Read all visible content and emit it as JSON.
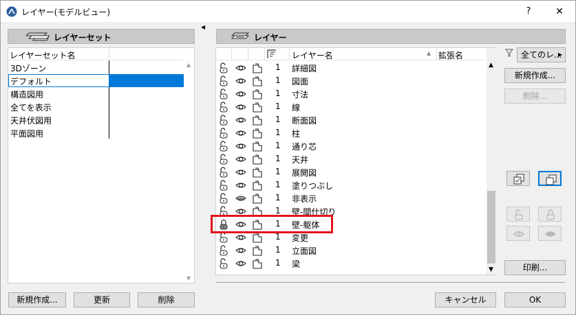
{
  "window": {
    "title": "レイヤー(モデルビュー)",
    "help": "?",
    "close": "✕"
  },
  "left_panel": {
    "header": "レイヤーセット",
    "column_header": "レイヤーセット名",
    "items": [
      "3Dゾーン",
      "デフォルト",
      "構造図用",
      "全てを表示",
      "天井伏図用",
      "平面図用"
    ],
    "selected_index": 1,
    "buttons": {
      "new": "新規作成...",
      "update": "更新",
      "delete": "削除"
    }
  },
  "right_panel": {
    "header": "レイヤー",
    "columns": {
      "name": "レイヤー名",
      "ext": "拡張名"
    },
    "rows": [
      {
        "lock": "unlocked",
        "visible": "eye",
        "num": "1",
        "name": "詳細図"
      },
      {
        "lock": "unlocked",
        "visible": "eye",
        "num": "1",
        "name": "図面"
      },
      {
        "lock": "unlocked",
        "visible": "eye",
        "num": "1",
        "name": "寸法"
      },
      {
        "lock": "unlocked",
        "visible": "eye",
        "num": "1",
        "name": "線"
      },
      {
        "lock": "unlocked",
        "visible": "eye",
        "num": "1",
        "name": "断面図"
      },
      {
        "lock": "unlocked",
        "visible": "eye",
        "num": "1",
        "name": "柱"
      },
      {
        "lock": "unlocked",
        "visible": "eye",
        "num": "1",
        "name": "通り芯"
      },
      {
        "lock": "unlocked",
        "visible": "eye",
        "num": "1",
        "name": "天井"
      },
      {
        "lock": "unlocked",
        "visible": "eye",
        "num": "1",
        "name": "展開図"
      },
      {
        "lock": "unlocked",
        "visible": "eye",
        "num": "1",
        "name": "塗りつぶし"
      },
      {
        "lock": "unlocked",
        "visible": "hidden",
        "num": "1",
        "name": "非表示"
      },
      {
        "lock": "unlocked",
        "visible": "eye",
        "num": "1",
        "name": "壁-間仕切り"
      },
      {
        "lock": "locked",
        "visible": "eye",
        "num": "1",
        "name": "壁-躯体"
      },
      {
        "lock": "unlocked",
        "visible": "eye",
        "num": "1",
        "name": "変更"
      },
      {
        "lock": "unlocked",
        "visible": "eye",
        "num": "1",
        "name": "立面図"
      },
      {
        "lock": "unlocked",
        "visible": "eye",
        "num": "1",
        "name": "梁"
      }
    ],
    "highlighted_row": 12
  },
  "side": {
    "filter_label": "全てのレ...",
    "new_button": "新規作成...",
    "delete_button": "削除...",
    "print_button": "印刷..."
  },
  "footer": {
    "cancel": "キャンセル",
    "ok": "OK"
  },
  "colors": {
    "selection": "#0078d7",
    "highlight_box": "#e0141e"
  }
}
